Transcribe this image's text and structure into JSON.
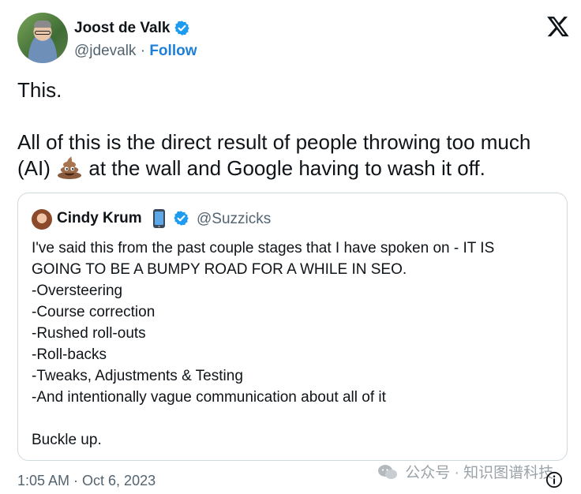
{
  "author": {
    "name": "Joost de Valk",
    "handle": "@jdevalk",
    "separator": "·",
    "follow_label": "Follow",
    "verified_color": "#1d9bf0"
  },
  "platform_logo": "x-logo-icon",
  "tweet": {
    "line1": "This.",
    "line2a": "All of this is the direct result of people throwing too much",
    "line2b_before_emoji": "(AI)",
    "emoji": "pile-of-poo-icon",
    "line2b_after_emoji": "at the wall and Google having to wash it off."
  },
  "quoted_tweet": {
    "name": "Cindy Krum",
    "name_emoji": "mobile-phone-icon",
    "handle": "@Suzzicks",
    "lines": [
      "I've said this from the past couple stages that I have spoken on - IT IS",
      "GOING TO BE A BUMPY ROAD FOR A WHILE IN SEO.",
      "-Oversteering",
      "-Course correction",
      "-Rushed roll-outs",
      "-Roll-backs",
      "-Tweaks, Adjustments & Testing",
      "-And intentionally vague communication about all of it"
    ],
    "closing": "Buckle up."
  },
  "timestamp": "1:05 AM · Oct 6, 2023",
  "watermark": "公众号 · 知识图谱科技",
  "colors": {
    "link": "#1d7fd6",
    "secondary_text": "#536471",
    "border": "#cfd9de"
  }
}
